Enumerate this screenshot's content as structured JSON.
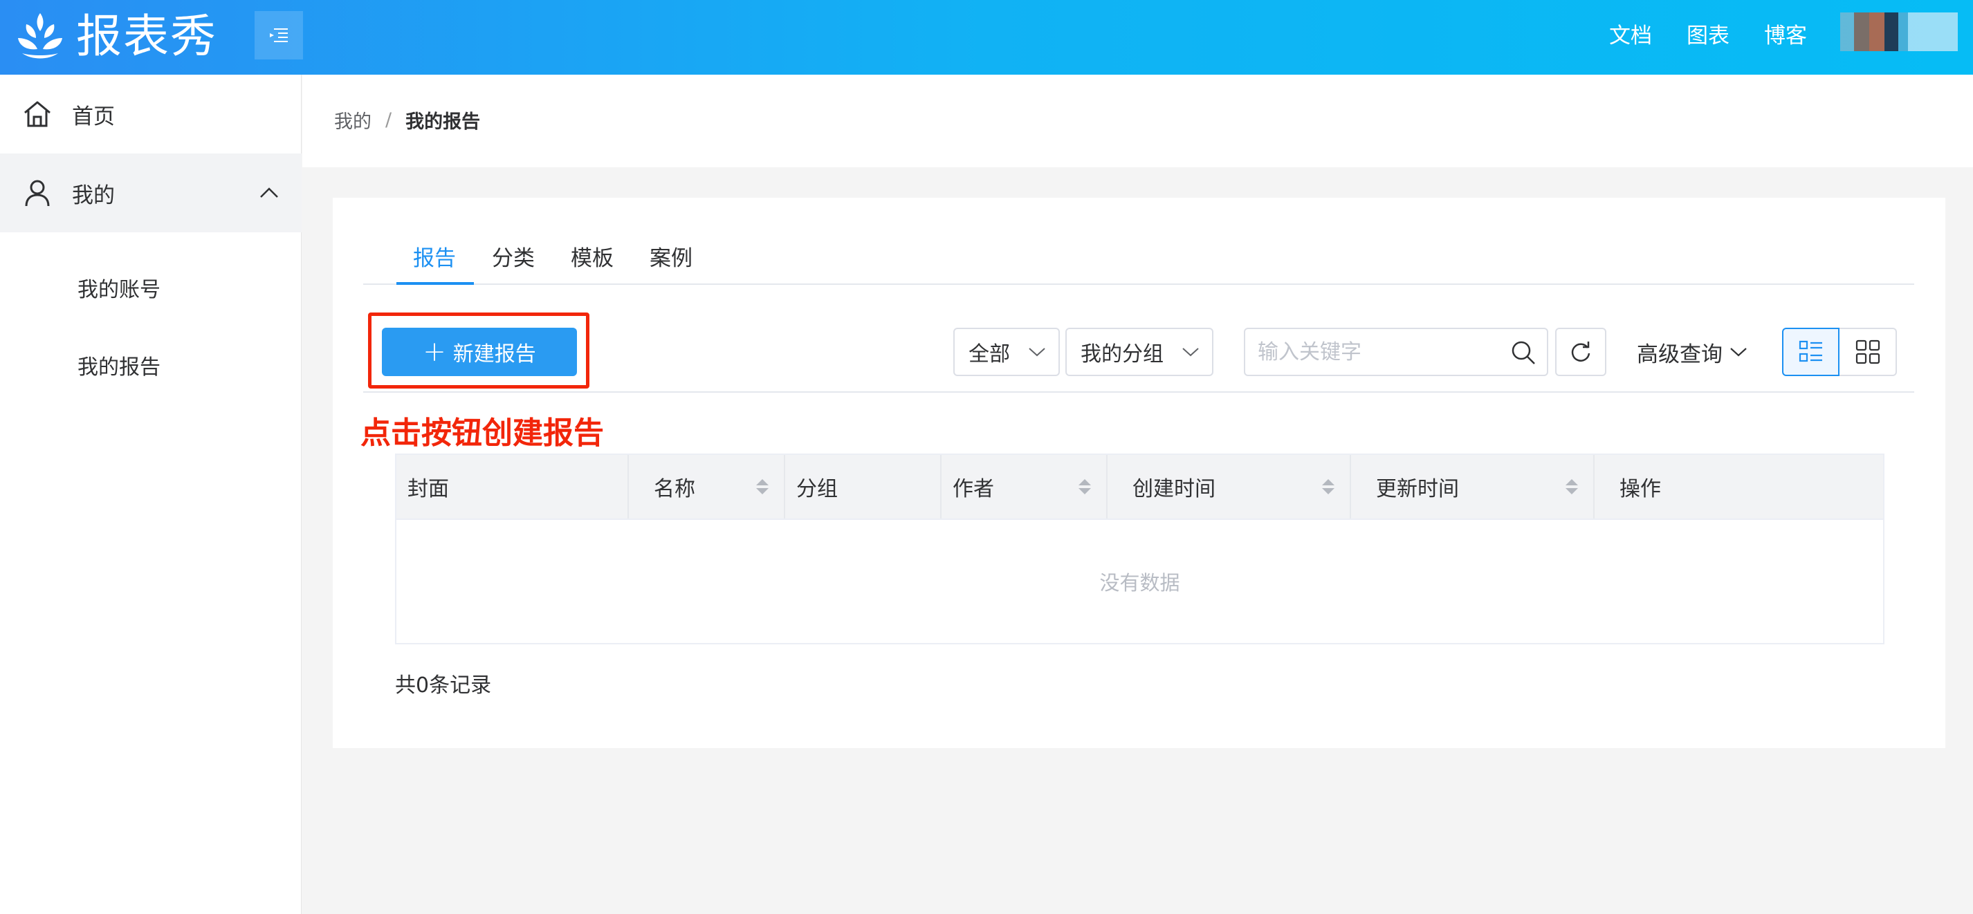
{
  "header": {
    "logo_text": "报表秀",
    "nav": [
      "文档",
      "图表",
      "博客"
    ],
    "menu_toggle_icon": "menu-fold-icon"
  },
  "sidebar": {
    "items": [
      {
        "label": "首页",
        "icon": "home-icon"
      },
      {
        "label": "我的",
        "icon": "user-icon",
        "expanded": true
      }
    ],
    "subitems": [
      "我的账号",
      "我的报告"
    ]
  },
  "breadcrumb": {
    "parent": "我的",
    "separator": "/",
    "current": "我的报告"
  },
  "tabs": [
    "报告",
    "分类",
    "模板",
    "案例"
  ],
  "active_tab": "报告",
  "toolbar": {
    "new_button": "新建报告",
    "filter_all": "全部",
    "filter_group": "我的分组",
    "search_placeholder": "输入关键字",
    "advanced": "高级查询"
  },
  "annotation": "点击按钮创建报告",
  "table": {
    "columns": [
      "封面",
      "名称",
      "分组",
      "作者",
      "创建时间",
      "更新时间",
      "操作"
    ],
    "sortable": [
      false,
      true,
      false,
      true,
      true,
      true,
      false
    ],
    "empty_text": "没有数据"
  },
  "footer": {
    "total": "共0条记录"
  },
  "colors": {
    "primary": "#1c90f2",
    "button": "#2a9bf2",
    "annotation": "#f2260a"
  }
}
